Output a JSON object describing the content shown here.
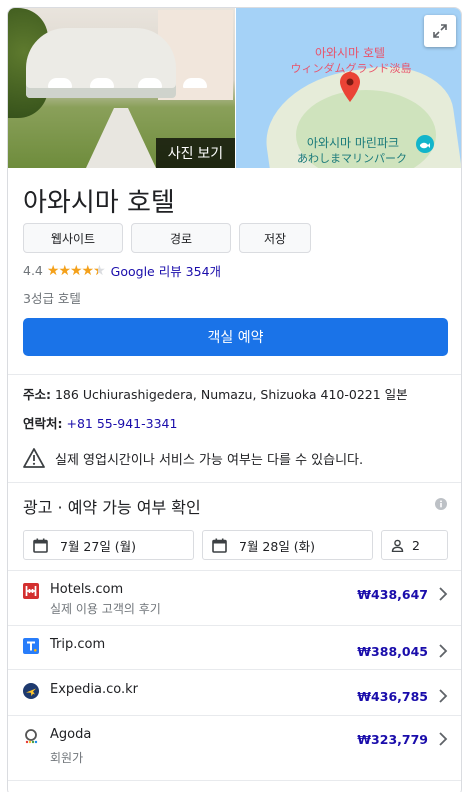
{
  "media": {
    "photo_button": "사진 보기",
    "map": {
      "label_ko": "아와시마 호텔",
      "label_jp": "ウィンダムグランド淡島",
      "poi_ko": "아와시마 마린파크",
      "poi_jp": "あわしまマリンパーク"
    }
  },
  "hotel": {
    "name": "아와시마 호텔",
    "rating": "4.4",
    "stars": 4.4,
    "reviews": "Google 리뷰 354개",
    "class": "3성급 호텔"
  },
  "actions": {
    "website": "웹사이트",
    "directions": "경로",
    "save": "저장"
  },
  "book_button": "객실 예약",
  "info": {
    "address_label": "주소:",
    "address": "186 Uchiurashigedera, Numazu, Shizuoka 410-0221 일본",
    "phone_label": "연락처:",
    "phone": "+81 55-941-3341"
  },
  "notice": "실제 영업시간이나 서비스 가능 여부는 다를 수 있습니다.",
  "availability": {
    "title": "광고 · 예약 가능 여부 확인",
    "checkin": "7월 27일 (월)",
    "checkout": "7월 28일 (화)",
    "guests": "2"
  },
  "offers": [
    {
      "name": "Hotels.com",
      "sub": "실제 이용 고객의 후기",
      "price": "₩438,647",
      "icon": "hotels-com-icon",
      "color": "#d32f2f"
    },
    {
      "name": "Trip.com",
      "sub": "",
      "price": "₩388,045",
      "icon": "trip-com-icon",
      "color": "#287dfa"
    },
    {
      "name": "Expedia.co.kr",
      "sub": "",
      "price": "₩436,785",
      "icon": "expedia-icon",
      "color": "#1e3a6e"
    },
    {
      "name": "Agoda",
      "sub": "회원가",
      "price": "₩323,779",
      "icon": "agoda-icon",
      "color": "#555555"
    }
  ],
  "colors": {
    "primary": "#1a73e8",
    "link": "#1a0dab",
    "star": "#f4a11b",
    "muted": "#70757a"
  }
}
